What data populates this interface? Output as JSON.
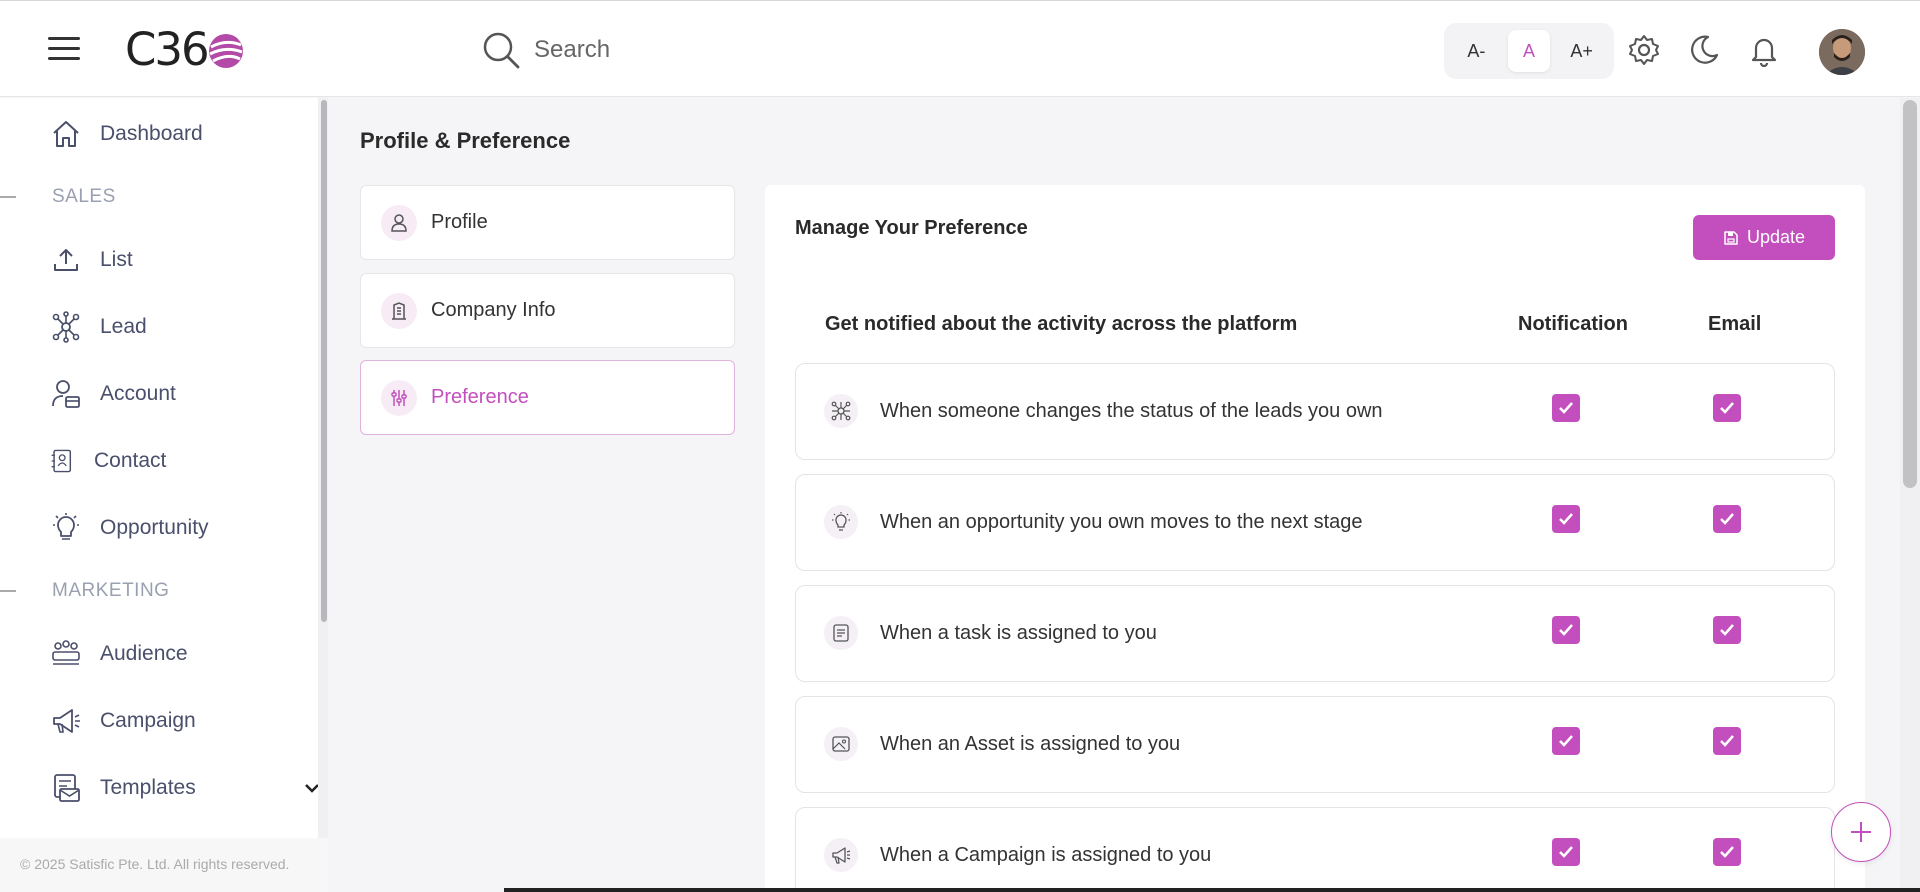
{
  "header": {
    "logo_text": "C36",
    "search_placeholder": "Search",
    "font_sizes": [
      "A-",
      "A",
      "A+"
    ],
    "active_font_size": "A"
  },
  "sidebar": {
    "items": [
      {
        "label": "Dashboard",
        "icon": "home-icon"
      },
      {
        "section": "SALES"
      },
      {
        "label": "List",
        "icon": "upload-icon"
      },
      {
        "label": "Lead",
        "icon": "network-icon"
      },
      {
        "label": "Account",
        "icon": "user-building-icon"
      },
      {
        "label": "Contact",
        "icon": "contact-card-icon"
      },
      {
        "label": "Opportunity",
        "icon": "lightbulb-icon"
      },
      {
        "section": "MARKETING"
      },
      {
        "label": "Audience",
        "icon": "group-icon"
      },
      {
        "label": "Campaign",
        "icon": "megaphone-icon"
      },
      {
        "label": "Templates",
        "icon": "mail-template-icon",
        "expandable": true
      }
    ],
    "copyright": "© 2025 Satisfic Pte. Ltd. All rights reserved."
  },
  "page": {
    "title": "Profile & Preference",
    "tabs": [
      {
        "label": "Profile",
        "icon": "user-icon",
        "active": false
      },
      {
        "label": "Company Info",
        "icon": "building-icon",
        "active": false
      },
      {
        "label": "Preference",
        "icon": "sliders-icon",
        "active": true
      }
    ]
  },
  "preference": {
    "title": "Manage Your Preference",
    "update_label": "Update",
    "table_header": "Get notified about the activity across the platform",
    "col_notification": "Notification",
    "col_email": "Email",
    "rows": [
      {
        "text": "When someone changes the status of the leads you own",
        "icon": "network-icon",
        "notification": true,
        "email": true
      },
      {
        "text": "When an opportunity you own moves to the next stage",
        "icon": "lightbulb-icon",
        "notification": true,
        "email": true
      },
      {
        "text": "When a task is assigned to you",
        "icon": "task-list-icon",
        "notification": true,
        "email": true
      },
      {
        "text": "When an Asset is assigned to you",
        "icon": "image-icon",
        "notification": true,
        "email": true
      },
      {
        "text": "When a Campaign is assigned to you",
        "icon": "megaphone-icon",
        "notification": true,
        "email": true
      }
    ]
  },
  "colors": {
    "accent": "#c34fbe",
    "nav_text": "#4a4f6b",
    "section_text": "#9aa0b0"
  }
}
